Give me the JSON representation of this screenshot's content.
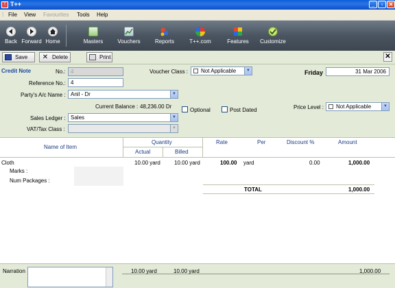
{
  "window": {
    "title": "T++",
    "min": "_",
    "max": "▫",
    "close": "✕"
  },
  "menu": {
    "items": [
      {
        "label": "File",
        "disabled": false
      },
      {
        "label": "View",
        "disabled": false
      },
      {
        "label": "Favourites",
        "disabled": true
      },
      {
        "label": "Tools",
        "disabled": false
      },
      {
        "label": "Help",
        "disabled": false
      }
    ]
  },
  "toolbar": {
    "back": "Back",
    "forward": "Forward",
    "home": "Home",
    "masters": "Masters",
    "vouchers": "Vouchers",
    "reports": "Reports",
    "tpp": "T++.com",
    "features": "Features",
    "customize": "Customize"
  },
  "formbar": {
    "save": "Save",
    "delete": "Delete",
    "print": "Print",
    "close": "✕"
  },
  "header": {
    "voucher_type": "Credit Note",
    "no_label": "No.:",
    "no_value": "4",
    "ref_label": "Reference No.:",
    "ref_value": "4",
    "party_label": "Party's A/c Name :",
    "party_value": "Anil - Dr",
    "balance_label": "Current Balance :",
    "balance_value": "48,236.00 Dr",
    "sales_ledger_label": "Sales Ledger :",
    "sales_ledger_value": "Sales",
    "vat_label": "VAT/Tax Class :",
    "vat_value": "",
    "voucher_class_label": "Voucher Class :",
    "voucher_class_value": "Not Applicable",
    "day": "Friday",
    "date": "31 Mar 2006",
    "optional_label": "Optional",
    "post_dated_label": "Post Dated",
    "price_level_label": "Price Level :",
    "price_level_value": "Not Applicable"
  },
  "table": {
    "col_item": "Name of Item",
    "col_quantity": "Quantity",
    "col_actual": "Actual",
    "col_billed": "Billed",
    "col_rate": "Rate",
    "col_per": "Per",
    "col_discount": "Discount %",
    "col_amount": "Amount",
    "row": {
      "item": "Cloth",
      "actual": "10.00 yard",
      "billed": "10.00 yard",
      "rate": "100.00",
      "per": "yard",
      "discount": "0.00",
      "amount": "1,000.00",
      "marks_label": "Marks :",
      "packages_label": "Num Packages :"
    },
    "total_label": "TOTAL",
    "total_amount": "1,000.00"
  },
  "footer": {
    "narration_label": "Narration",
    "actual_total": "10.00 yard",
    "billed_total": "10.00 yard",
    "amount_total": "1,000.00"
  }
}
